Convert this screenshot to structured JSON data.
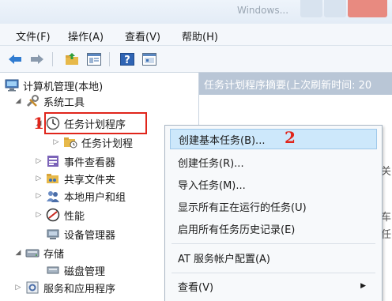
{
  "window": {
    "title": "Windows..."
  },
  "menu": [
    "文件(F)",
    "操作(A)",
    "查看(V)",
    "帮助(H)"
  ],
  "toolbar": {
    "buttons": [
      "back-icon",
      "forward-icon",
      "folder-up-icon",
      "show-hide-tree-icon",
      "help-icon",
      "properties-icon"
    ]
  },
  "tree": {
    "root": "计算机管理(本地)",
    "system_tools": "系统工具",
    "task_scheduler": "任务计划程序",
    "task_scheduler_lib": "任务计划程",
    "event_viewer": "事件查看器",
    "shared_folders": "共享文件夹",
    "local_users": "本地用户和组",
    "performance": "性能",
    "device_manager": "设备管理器",
    "storage": "存储",
    "disk_management": "磁盘管理",
    "services_apps": "服务和应用程序"
  },
  "right_pane": {
    "header": "任务计划程序摘要(上次刷新时间: 20",
    "frag1": "关",
    "frag2": "车",
    "frag3": "任"
  },
  "context_menu": {
    "items": [
      "创建基本任务(B)...",
      "创建任务(R)...",
      "导入任务(M)...",
      "显示所有正在运行的任务(U)",
      "启用所有任务历史记录(E)",
      "AT 服务帐户配置(A)",
      "查看(V)"
    ]
  },
  "annotations": {
    "step1": "1",
    "step2": "2"
  },
  "colors": {
    "annotation_red": "#e0251b",
    "header_bg": "#b9c6d6",
    "highlight": "#cde8fb"
  }
}
